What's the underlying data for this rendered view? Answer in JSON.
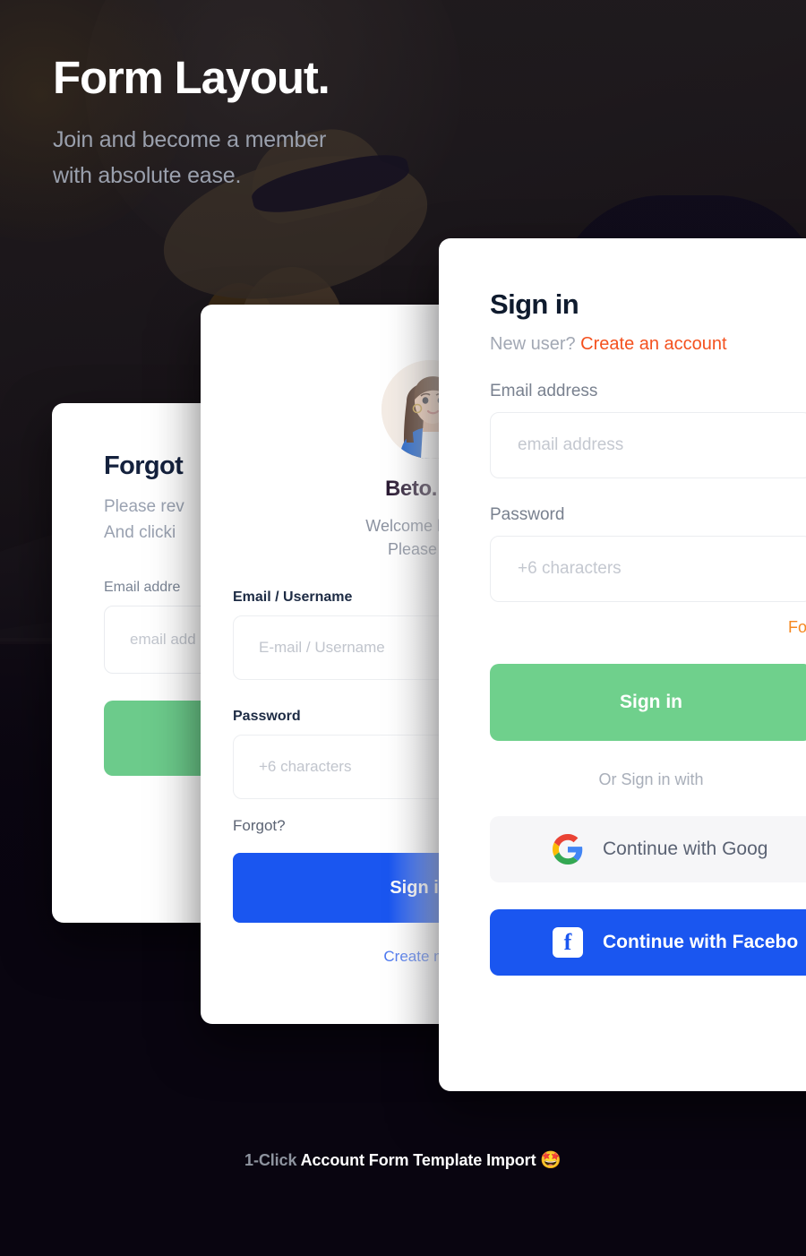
{
  "hero": {
    "title": "Form Layout.",
    "subtitle_line1": "Join and become a member",
    "subtitle_line2": "with absolute ease.",
    "background_illustration": "hiker-with-hat-backpack-sunset"
  },
  "colors": {
    "page_background": "#090510",
    "accent_green": "#6fd08c",
    "accent_blue": "#1a56f0",
    "accent_orange": "#f5871f",
    "link_orange": "#f4511e",
    "link_blue": "#4c78f0",
    "card_white": "#ffffff",
    "muted_text": "#9aa2b1",
    "heading_navy": "#14213d"
  },
  "cards": {
    "forgot": {
      "title": "Forgot",
      "description_line1": "Please rev",
      "description_line2": "And clicki",
      "email_label": "Email addre",
      "email_placeholder": "email add",
      "submit_button_label": ""
    },
    "beto": {
      "avatar_name": "avatar-woman-illustration",
      "name": "Beto.",
      "welcome_line1": "Welcome back",
      "welcome_line2": "Please sign",
      "email_label": "Email / Username",
      "email_placeholder": "E-mail / Username",
      "password_label": "Password",
      "password_placeholder": "+6 characters",
      "forgot_label": "Forgot?",
      "submit_button_label": "Sign in",
      "create_account_label": "Create new ac"
    },
    "signin": {
      "title": "Sign in",
      "new_user_text": "New user?",
      "create_account_link": "Create an account",
      "email_label": "Email address",
      "email_placeholder": "email address",
      "password_label": "Password",
      "password_placeholder": "+6 characters",
      "forgot_link": "For",
      "submit_button_label": "Sign in",
      "or_divider": "Or Sign in with",
      "google_button_label": "Continue with Goog",
      "facebook_button_label": "Continue with Facebo",
      "google_icon": "google-g-icon",
      "facebook_icon": "facebook-f-icon"
    }
  },
  "footer": {
    "accent_text": "1-Click",
    "main_text": "Account Form Template Import",
    "emoji": "🤩"
  }
}
